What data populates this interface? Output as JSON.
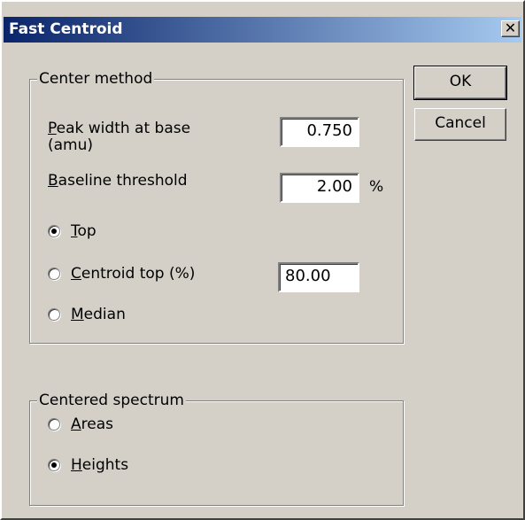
{
  "window": {
    "title": "Fast Centroid",
    "close_glyph": "✕"
  },
  "buttons": {
    "ok": "OK",
    "cancel": "Cancel"
  },
  "center_method": {
    "legend": "Center method",
    "peak_width": {
      "key": "P",
      "rest_line1": "eak width at base",
      "line2": "(amu)",
      "value": "0.750"
    },
    "baseline": {
      "key": "B",
      "rest": "aseline threshold",
      "value": "2.00",
      "unit": "%"
    },
    "options": [
      {
        "key": "T",
        "rest": "op",
        "selected": true
      },
      {
        "key": "C",
        "rest": "entroid top (%)",
        "selected": false,
        "value": "80.00"
      },
      {
        "key": "M",
        "rest": "edian",
        "selected": false
      }
    ]
  },
  "centered_spectrum": {
    "legend": "Centered spectrum",
    "options": [
      {
        "key": "A",
        "rest": "reas",
        "selected": false
      },
      {
        "key": "H",
        "rest": "eights",
        "selected": true
      }
    ]
  }
}
